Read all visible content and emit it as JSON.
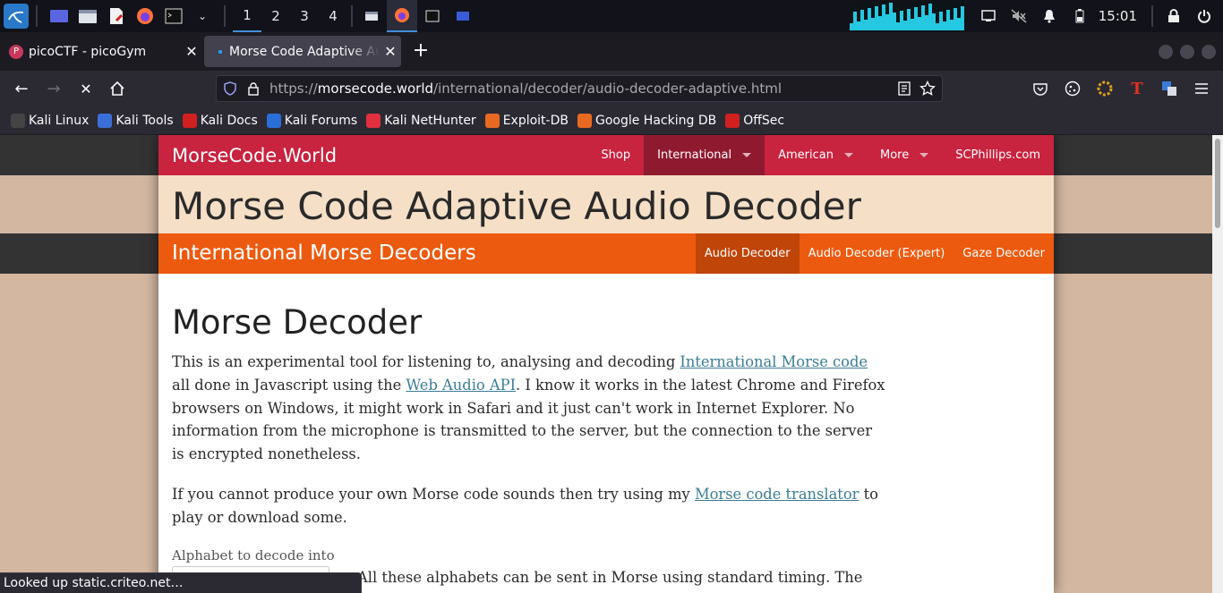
{
  "taskbar": {
    "workspaces": [
      "1",
      "2",
      "3",
      "4"
    ],
    "active_workspace": "1",
    "clock": "15:01",
    "launchers": [
      "kali-menu-icon",
      "desktop-icon",
      "files-icon",
      "text-editor-icon",
      "firefox-icon",
      "terminal-icon"
    ]
  },
  "tabs": [
    {
      "title": "picoCTF - picoGym",
      "active": false
    },
    {
      "title": "Morse Code Adaptive Aud",
      "active": true
    }
  ],
  "url": {
    "scheme": "https://",
    "host": "morsecode.world",
    "path": "/international/decoder/audio-decoder-adaptive.html"
  },
  "bookmarks": [
    "Kali Linux",
    "Kali Tools",
    "Kali Docs",
    "Kali Forums",
    "Kali NetHunter",
    "Exploit-DB",
    "Google Hacking DB",
    "OffSec"
  ],
  "site": {
    "brand": "MorseCode.World",
    "nav": [
      {
        "label": "Shop",
        "caret": false,
        "active": false
      },
      {
        "label": "International",
        "caret": true,
        "active": true
      },
      {
        "label": "American",
        "caret": true,
        "active": false
      },
      {
        "label": "More",
        "caret": true,
        "active": false
      },
      {
        "label": "SCPhillips.com",
        "caret": false,
        "active": false
      }
    ],
    "title": "Morse Code Adaptive Audio Decoder",
    "subtitle": "International Morse Decoders",
    "subnav": [
      {
        "label": "Audio Decoder",
        "active": true
      },
      {
        "label": "Audio Decoder (Expert)",
        "active": false
      },
      {
        "label": "Gaze Decoder",
        "active": false
      }
    ],
    "heading": "Morse Decoder",
    "p1": {
      "t1": "This is an experimental tool for listening to, analysing and decoding ",
      "link1": "International Morse code",
      "t2": " all done in Javascript using the ",
      "link2": "Web Audio API",
      "t3": ". I know it works in the latest Chrome and Firefox browsers on Windows, it might work in Safari and it just can't work in Internet Explorer. No information from the microphone is transmitted to the server, but the connection to the server is encrypted nonetheless."
    },
    "p2": {
      "t1": "If you cannot produce your own Morse code sounds then try using my ",
      "link1": "Morse code translator",
      "t2": " to play or download some."
    },
    "alphabet_label": "Alphabet to decode into",
    "p3": "All these alphabets can be sent in Morse using standard timing. The"
  },
  "status": "Looked up static.criteo.net…",
  "colors": {
    "site_red": "#c8233f",
    "site_orange": "#ec5a0f",
    "title_band": "#f5dfc6",
    "page_bg": "#d3b7a1",
    "link": "#3a7d96"
  }
}
